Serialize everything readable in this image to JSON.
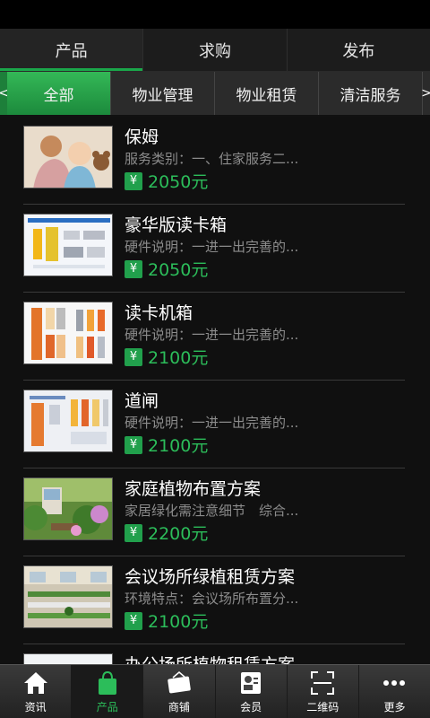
{
  "top_tabs": [
    {
      "label": "产品",
      "active": true
    },
    {
      "label": "求购",
      "active": false
    },
    {
      "label": "发布",
      "active": false
    }
  ],
  "sub_tabs": [
    {
      "label": "全部",
      "active": true
    },
    {
      "label": "物业管理",
      "active": false
    },
    {
      "label": "物业租赁",
      "active": false
    },
    {
      "label": "清洁服务",
      "active": false
    }
  ],
  "arrows": {
    "left": "<",
    "right": ">"
  },
  "currency_symbol": "¥",
  "items": [
    {
      "title": "保姆",
      "desc": "服务类别：一、住家服务二...",
      "price": "2050元"
    },
    {
      "title": "豪华版读卡箱",
      "desc": "硬件说明：一进一出完善的...",
      "price": "2050元"
    },
    {
      "title": "读卡机箱",
      "desc": "硬件说明：一进一出完善的...",
      "price": "2100元"
    },
    {
      "title": "道闸",
      "desc": "硬件说明：一进一出完善的...",
      "price": "2100元"
    },
    {
      "title": "家庭植物布置方案",
      "desc": "家居绿化需注意细节　综合...",
      "price": "2200元"
    },
    {
      "title": "会议场所绿植租赁方案",
      "desc": "环境特点：会议场所布置分...",
      "price": "2100元"
    },
    {
      "title": "办公场所植物租赁方案",
      "desc": "",
      "price": ""
    }
  ],
  "bottom_nav": [
    {
      "label": "资讯",
      "icon": "home-icon",
      "active": false
    },
    {
      "label": "产品",
      "icon": "shopping-bag-icon",
      "active": true
    },
    {
      "label": "商铺",
      "icon": "open-sign-icon",
      "active": false
    },
    {
      "label": "会员",
      "icon": "member-card-icon",
      "active": false
    },
    {
      "label": "二维码",
      "icon": "qr-scan-icon",
      "active": false
    },
    {
      "label": "更多",
      "icon": "more-dots-icon",
      "active": false
    }
  ],
  "colors": {
    "accent": "#1aa74a",
    "price": "#2cbd5a",
    "background": "#101010"
  }
}
